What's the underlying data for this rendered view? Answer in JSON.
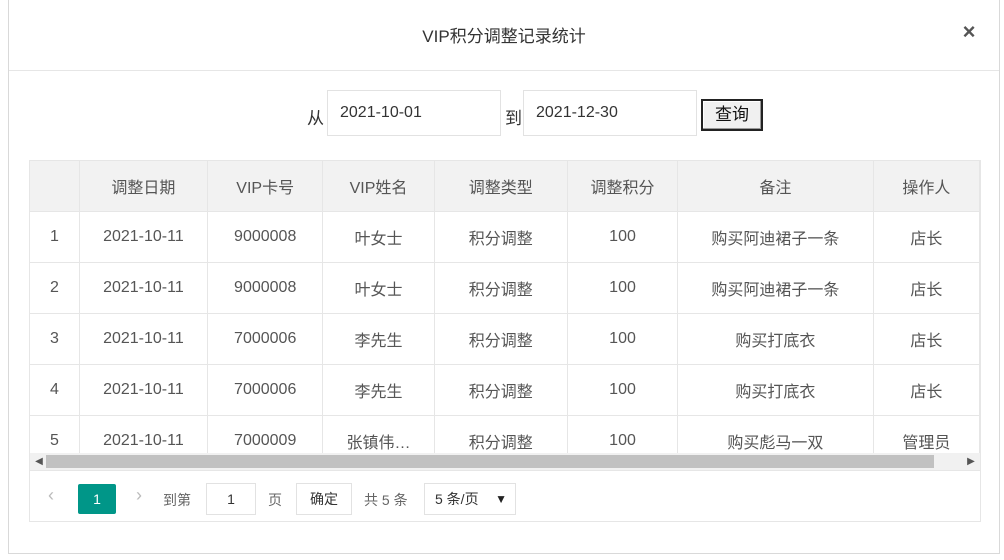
{
  "dialog": {
    "title": "VIP积分调整记录统计",
    "close_glyph": "×"
  },
  "filter": {
    "from_label": "从",
    "from_value": "2021-10-01",
    "to_label": "到",
    "to_value": "2021-12-30",
    "query_label": "查询"
  },
  "table": {
    "columns": [
      "",
      "调整日期",
      "VIP卡号",
      "VIP姓名",
      "调整类型",
      "调整积分",
      "备注",
      "操作人"
    ],
    "rows": [
      [
        "1",
        "2021-10-11",
        "9000008",
        "叶女士",
        "积分调整",
        "100",
        "购买阿迪裙子一条",
        "店长"
      ],
      [
        "2",
        "2021-10-11",
        "9000008",
        "叶女士",
        "积分调整",
        "100",
        "购买阿迪裙子一条",
        "店长"
      ],
      [
        "3",
        "2021-10-11",
        "7000006",
        "李先生",
        "积分调整",
        "100",
        "购买打底衣",
        "店长"
      ],
      [
        "4",
        "2021-10-11",
        "7000006",
        "李先生",
        "积分调整",
        "100",
        "购买打底衣",
        "店长"
      ],
      [
        "5",
        "2021-10-11",
        "7000009",
        "张镇伟…",
        "积分调整",
        "100",
        "购买彪马一双",
        "管理员"
      ]
    ]
  },
  "pager": {
    "prev_glyph": "‹",
    "current_page": "1",
    "next_glyph": "›",
    "goto_label": "到第",
    "goto_value": "1",
    "page_label": "页",
    "ok_label": "确定",
    "total_label": "共 5 条",
    "page_size": "5 条/页"
  },
  "scrollbar": {
    "left_arrow": "◀",
    "right_arrow": "▶"
  }
}
